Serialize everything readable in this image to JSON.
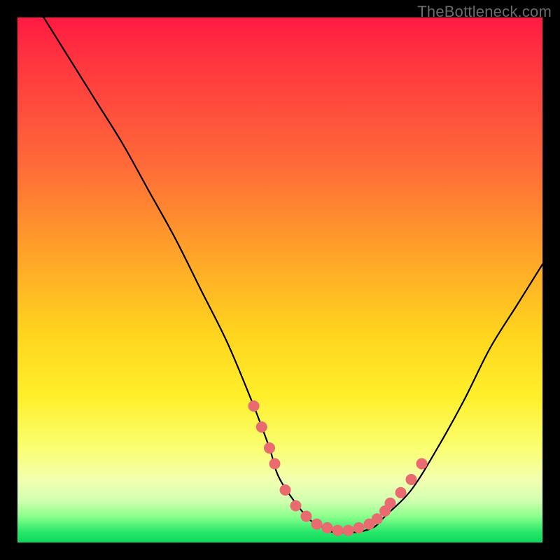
{
  "attribution": "TheBottleneck.com",
  "chart_data": {
    "type": "line",
    "title": "",
    "xlabel": "",
    "ylabel": "",
    "xlim": [
      0,
      100
    ],
    "ylim": [
      0,
      100
    ],
    "series": [
      {
        "name": "curve",
        "x": [
          5,
          10,
          15,
          20,
          25,
          30,
          35,
          40,
          45,
          48,
          50,
          55,
          58,
          60,
          63,
          65,
          68,
          70,
          75,
          80,
          85,
          90,
          95,
          100
        ],
        "y": [
          100,
          92,
          84,
          76,
          67,
          58,
          48,
          38,
          26,
          18,
          12,
          5,
          3,
          2,
          2,
          2,
          3,
          5,
          10,
          18,
          27,
          37,
          45,
          53
        ]
      }
    ],
    "markers": {
      "name": "dots",
      "color": "#e96a6f",
      "x": [
        45,
        46.5,
        48,
        49,
        51,
        53,
        55,
        57,
        59,
        61,
        63,
        65,
        67,
        68.5,
        70,
        71,
        73,
        75,
        77
      ],
      "y": [
        26,
        22,
        18,
        15,
        10,
        7,
        5,
        3.5,
        2.8,
        2.3,
        2.3,
        2.8,
        3.5,
        4.5,
        6,
        7.5,
        9.5,
        12,
        15
      ]
    }
  }
}
